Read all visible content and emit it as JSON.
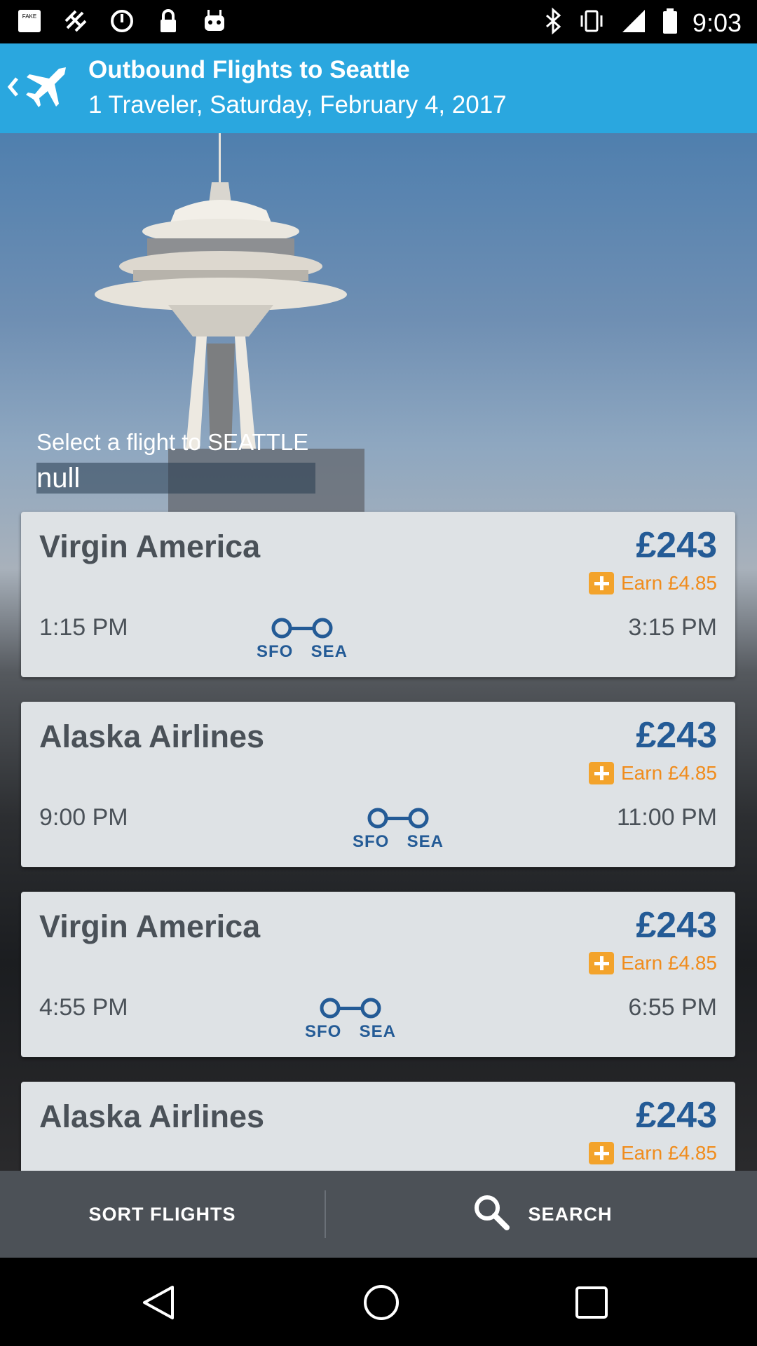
{
  "status_bar": {
    "time": "9:03",
    "left_icons": [
      "fake-gps-icon",
      "satellite-icon",
      "alarm-icon",
      "lock-icon",
      "robot-icon"
    ],
    "right_icons": [
      "bluetooth-icon",
      "vibrate-icon",
      "signal-icon",
      "battery-icon"
    ]
  },
  "header": {
    "title": "Outbound Flights to Seattle",
    "subtitle": "1 Traveler, Saturday, February 4, 2017",
    "background_color": "#2aa7df"
  },
  "hero": {
    "select_title": "Select a flight to SEATTLE",
    "sub_label": "null"
  },
  "flights": [
    {
      "airline": "Virgin America",
      "price": "£243",
      "earn": "Earn £4.85",
      "depart": "1:15 PM",
      "arrive": "3:15 PM",
      "from": "SFO",
      "to": "SEA"
    },
    {
      "airline": "Alaska Airlines",
      "price": "£243",
      "earn": "Earn £4.85",
      "depart": "9:00 PM",
      "arrive": "11:00 PM",
      "from": "SFO",
      "to": "SEA"
    },
    {
      "airline": "Virgin America",
      "price": "£243",
      "earn": "Earn £4.85",
      "depart": "4:55 PM",
      "arrive": "6:55 PM",
      "from": "SFO",
      "to": "SEA"
    },
    {
      "airline": "Alaska Airlines",
      "price": "£243",
      "earn": "Earn £4.85"
    }
  ],
  "bottom_bar": {
    "sort_label": "SORT FLIGHTS",
    "search_label": "SEARCH"
  },
  "colors": {
    "price": "#245b96",
    "earn": "#f08c1c",
    "card": "#dee2e5",
    "bottom_bar": "#4c5157"
  }
}
